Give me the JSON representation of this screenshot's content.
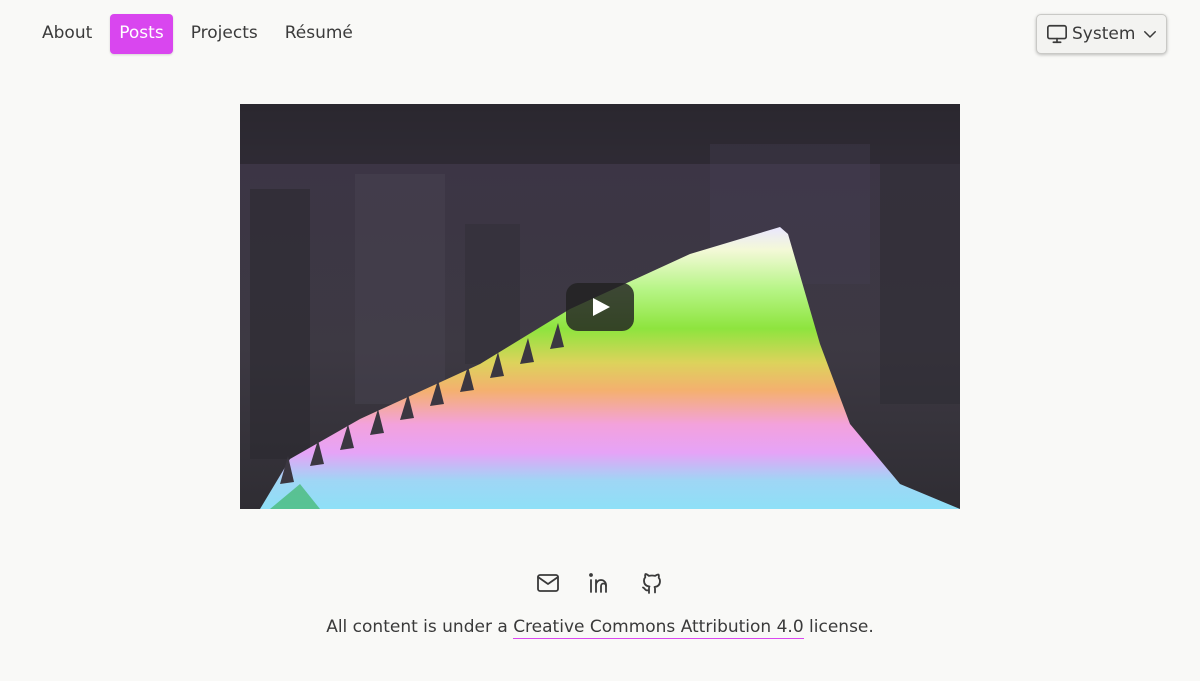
{
  "nav": {
    "items": [
      {
        "label": "About",
        "active": false
      },
      {
        "label": "Posts",
        "active": true
      },
      {
        "label": "Projects",
        "active": false
      },
      {
        "label": "Résumé",
        "active": false
      }
    ]
  },
  "theme": {
    "label": "System",
    "icon": "monitor-icon"
  },
  "video": {
    "play_icon": "play-icon"
  },
  "socials": [
    "mail-icon",
    "linkedin-icon",
    "github-icon"
  ],
  "footer": {
    "prefix": "All content is under a",
    "link": "Creative Commons Attribution 4.0",
    "suffix": "license."
  },
  "colors": {
    "accent": "#d946ef",
    "background": "#f9f9f7"
  }
}
